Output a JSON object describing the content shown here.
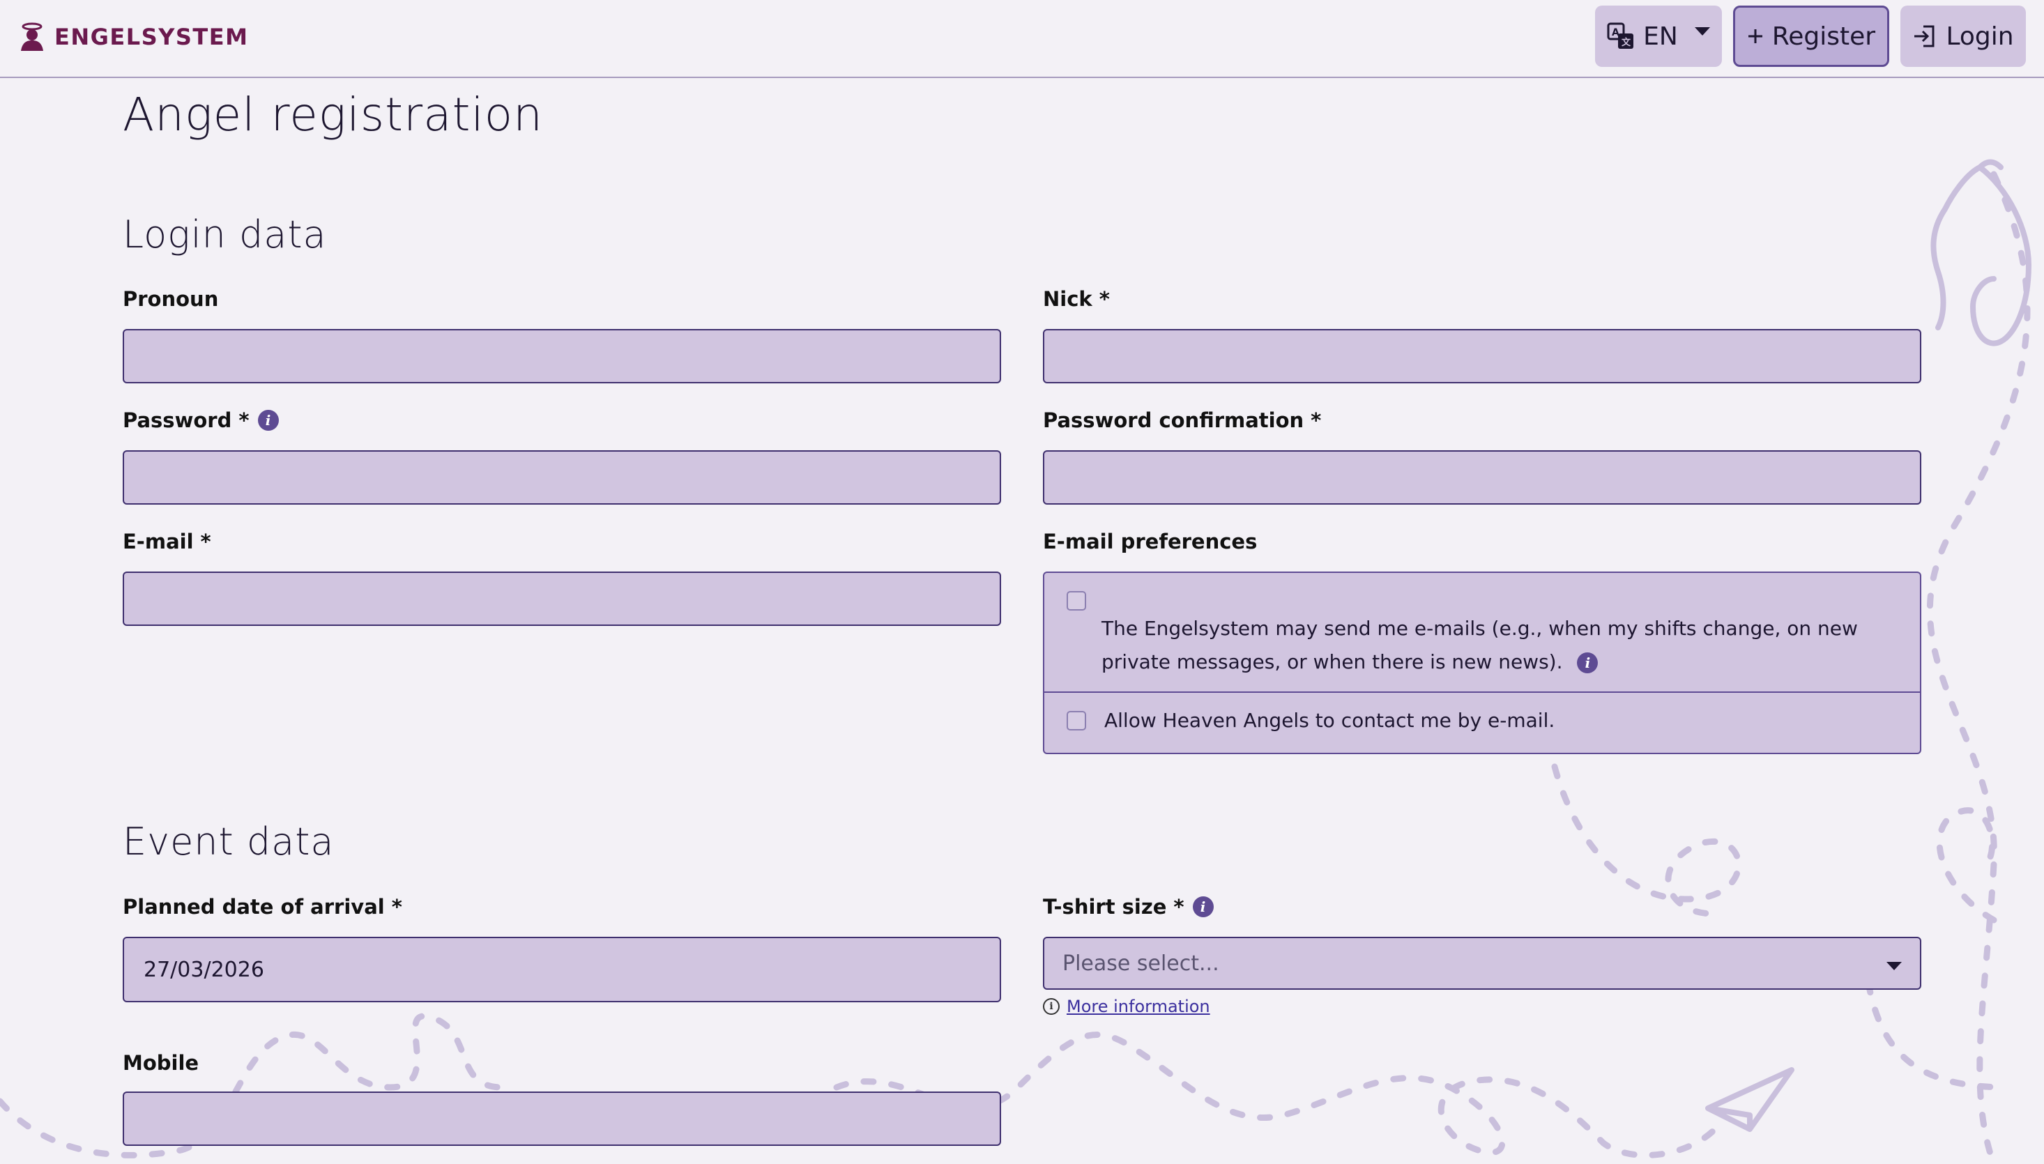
{
  "navbar": {
    "brand": "ENGELSYSTEM",
    "language_label": "EN",
    "register_label": "Register",
    "login_label": "Login"
  },
  "page": {
    "title": "Angel registration"
  },
  "login_section": {
    "heading": "Login data",
    "pronoun_label": "Pronoun",
    "nick_label": "Nick",
    "password_label": "Password",
    "password_confirmation_label": "Password confirmation",
    "email_label": "E-mail",
    "email_preferences_label": "E-mail preferences",
    "pref_shift_mails": "The Engelsystem may send me e-mails (e.g., when my shifts change, on new private messages, or when there is new news).",
    "pref_heaven_contact": "Allow Heaven Angels to contact me by e-mail."
  },
  "event_section": {
    "heading": "Event data",
    "arrival_label": "Planned date of arrival",
    "arrival_value": "27/03/2026",
    "tshirt_label": "T-shirt size",
    "tshirt_placeholder": "Please select...",
    "more_info_link": "More information",
    "mobile_label": "Mobile"
  },
  "required_marker": "*",
  "info_glyph": "i",
  "colors": {
    "brand": "#6b1a4e",
    "accent": "#5e4b93",
    "field_bg": "#d1c5e0",
    "page_bg": "#f3f1f6"
  }
}
